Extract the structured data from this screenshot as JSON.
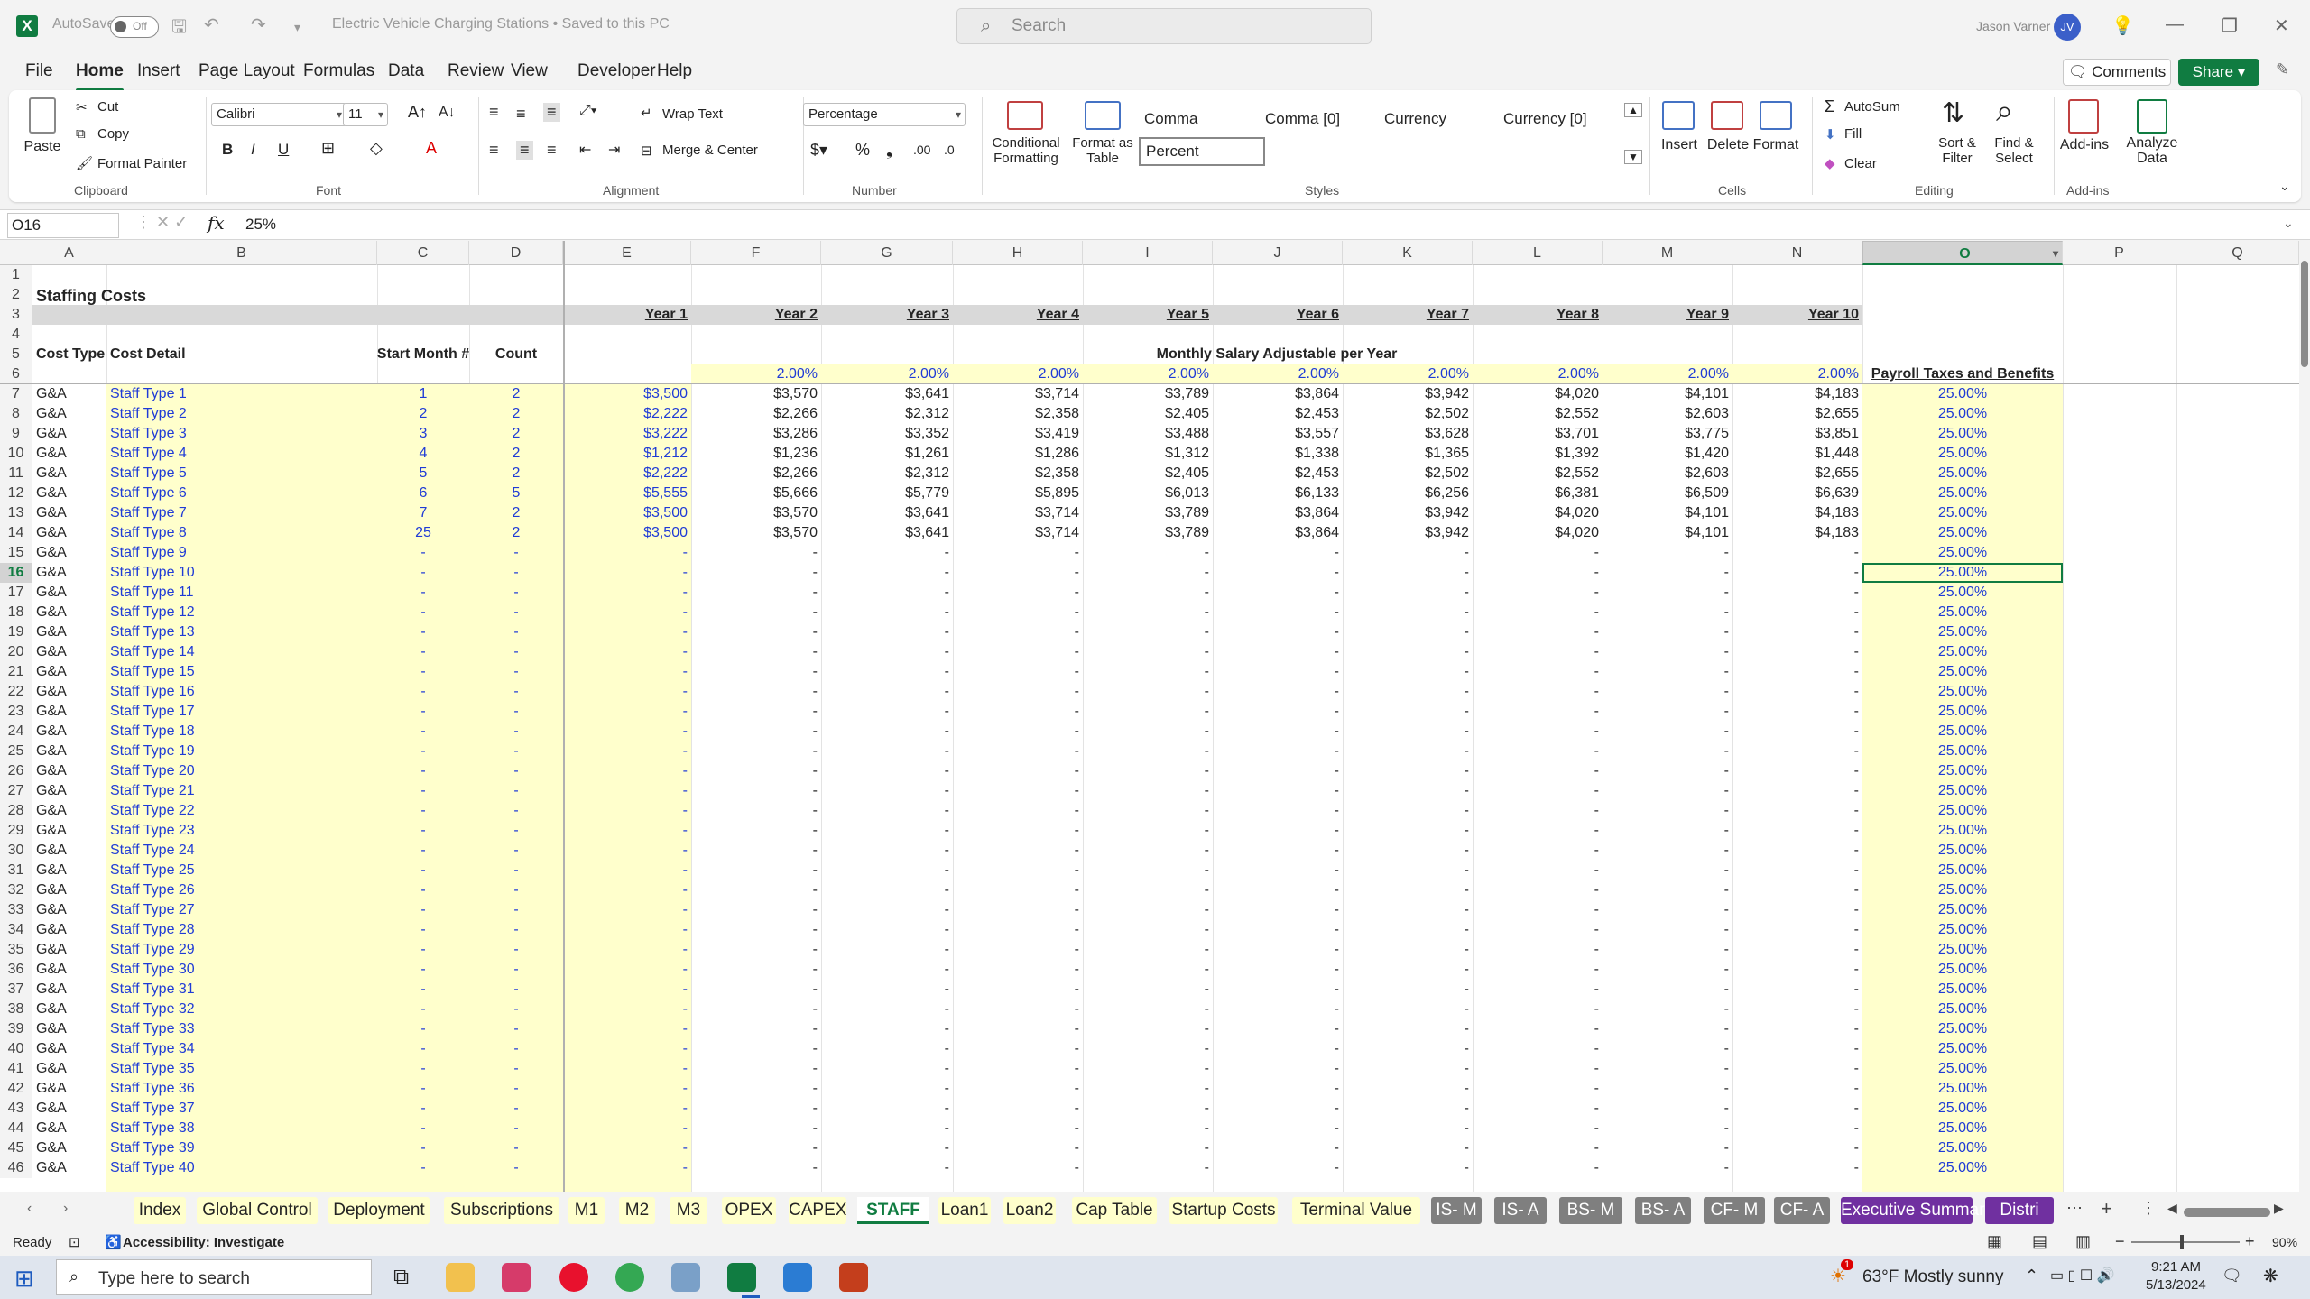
{
  "app": {
    "title": "Electric Vehicle Charging Stations  •  Saved to this PC",
    "autosave_label": "AutoSave",
    "autosave_state": "Off",
    "search_placeholder": "Search",
    "user_name": "Jason Varner",
    "user_initials": "JV"
  },
  "menu": [
    "File",
    "Home",
    "Insert",
    "Page Layout",
    "Formulas",
    "Data",
    "Review",
    "View",
    "Developer",
    "Help"
  ],
  "menu_active": "Home",
  "buttons": {
    "comments": "Comments",
    "share": "Share"
  },
  "ribbon": {
    "clipboard": {
      "paste": "Paste",
      "cut": "Cut",
      "copy": "Copy",
      "format_painter": "Format Painter",
      "group": "Clipboard"
    },
    "font": {
      "name": "Calibri",
      "size": "11",
      "group": "Font"
    },
    "alignment": {
      "wrap": "Wrap Text",
      "merge": "Merge & Center",
      "group": "Alignment"
    },
    "number": {
      "format": "Percentage",
      "group": "Number"
    },
    "styles": {
      "conditional": "Conditional Formatting",
      "format_table": "Format as Table",
      "cells": [
        "Comma",
        "Comma [0]",
        "Currency",
        "Currency [0]",
        "Percent"
      ],
      "group": "Styles"
    },
    "cells": {
      "insert": "Insert",
      "delete": "Delete",
      "format": "Format",
      "group": "Cells"
    },
    "editing": {
      "autosum": "AutoSum",
      "fill": "Fill",
      "clear": "Clear",
      "sort": "Sort & Filter",
      "find": "Find & Select",
      "group": "Editing"
    },
    "addins": {
      "addins": "Add-ins",
      "analyze": "Analyze Data",
      "group": "Add-ins"
    }
  },
  "formula_bar": {
    "cell": "O16",
    "value": "25%"
  },
  "columns": [
    "A",
    "B",
    "C",
    "D",
    "E",
    "F",
    "G",
    "H",
    "I",
    "J",
    "K",
    "L",
    "M",
    "N",
    "O",
    "P",
    "Q"
  ],
  "sheet": {
    "title": "Staffing Costs",
    "years": [
      "Year 1",
      "Year 2",
      "Year 3",
      "Year 4",
      "Year 5",
      "Year 6",
      "Year 7",
      "Year 8",
      "Year 9",
      "Year 10"
    ],
    "headers": {
      "cost_type": "Cost Type",
      "cost_detail": "Cost Detail",
      "start_month": "Start Month #",
      "count": "Count",
      "monthly": "Monthly Salary Adjustable per Year",
      "payroll": "Payroll Taxes and Benefits"
    },
    "growth": "2.00%",
    "payroll_rate": "25.00%",
    "dash": "-",
    "staff": [
      {
        "type": "G&A",
        "detail": "Staff Type 1",
        "start": "1",
        "count": "2",
        "salary": [
          "$3,500",
          "$3,570",
          "$3,641",
          "$3,714",
          "$3,789",
          "$3,864",
          "$3,942",
          "$4,020",
          "$4,101",
          "$4,183"
        ]
      },
      {
        "type": "G&A",
        "detail": "Staff Type 2",
        "start": "2",
        "count": "2",
        "salary": [
          "$2,222",
          "$2,266",
          "$2,312",
          "$2,358",
          "$2,405",
          "$2,453",
          "$2,502",
          "$2,552",
          "$2,603",
          "$2,655"
        ]
      },
      {
        "type": "G&A",
        "detail": "Staff Type 3",
        "start": "3",
        "count": "2",
        "salary": [
          "$3,222",
          "$3,286",
          "$3,352",
          "$3,419",
          "$3,488",
          "$3,557",
          "$3,628",
          "$3,701",
          "$3,775",
          "$3,851"
        ]
      },
      {
        "type": "G&A",
        "detail": "Staff Type 4",
        "start": "4",
        "count": "2",
        "salary": [
          "$1,212",
          "$1,236",
          "$1,261",
          "$1,286",
          "$1,312",
          "$1,338",
          "$1,365",
          "$1,392",
          "$1,420",
          "$1,448"
        ]
      },
      {
        "type": "G&A",
        "detail": "Staff Type 5",
        "start": "5",
        "count": "2",
        "salary": [
          "$2,222",
          "$2,266",
          "$2,312",
          "$2,358",
          "$2,405",
          "$2,453",
          "$2,502",
          "$2,552",
          "$2,603",
          "$2,655"
        ]
      },
      {
        "type": "G&A",
        "detail": "Staff Type 6",
        "start": "6",
        "count": "5",
        "salary": [
          "$5,555",
          "$5,666",
          "$5,779",
          "$5,895",
          "$6,013",
          "$6,133",
          "$6,256",
          "$6,381",
          "$6,509",
          "$6,639"
        ]
      },
      {
        "type": "G&A",
        "detail": "Staff Type 7",
        "start": "7",
        "count": "2",
        "salary": [
          "$3,500",
          "$3,570",
          "$3,641",
          "$3,714",
          "$3,789",
          "$3,864",
          "$3,942",
          "$4,020",
          "$4,101",
          "$4,183"
        ]
      },
      {
        "type": "G&A",
        "detail": "Staff Type 8",
        "start": "25",
        "count": "2",
        "salary": [
          "$3,500",
          "$3,570",
          "$3,641",
          "$3,714",
          "$3,789",
          "$3,864",
          "$3,942",
          "$4,020",
          "$4,101",
          "$4,183"
        ]
      }
    ],
    "empty_types": [
      "Staff Type 9",
      "Staff Type 10",
      "Staff Type 11",
      "Staff Type 12",
      "Staff Type 13",
      "Staff Type 14",
      "Staff Type 15",
      "Staff Type 16",
      "Staff Type 17",
      "Staff Type 18",
      "Staff Type 19",
      "Staff Type 20",
      "Staff Type 21",
      "Staff Type 22",
      "Staff Type 23",
      "Staff Type 24",
      "Staff Type 25",
      "Staff Type 26",
      "Staff Type 27",
      "Staff Type 28",
      "Staff Type 29",
      "Staff Type 30",
      "Staff Type 31",
      "Staff Type 32",
      "Staff Type 33",
      "Staff Type 34",
      "Staff Type 35",
      "Staff Type 36",
      "Staff Type 37",
      "Staff Type 38",
      "Staff Type 39",
      "Staff Type 40"
    ],
    "row_numbers": [
      "1",
      "2",
      "3",
      "4",
      "5",
      "6",
      "7",
      "8",
      "9",
      "10",
      "11",
      "12",
      "13",
      "14",
      "15",
      "16",
      "17",
      "18",
      "19",
      "20",
      "21",
      "22",
      "23",
      "24",
      "25",
      "26",
      "27",
      "28",
      "29",
      "30",
      "31",
      "32",
      "33",
      "34",
      "35",
      "36",
      "37",
      "38",
      "39",
      "40",
      "41",
      "42",
      "43",
      "44",
      "45",
      "46"
    ]
  },
  "tabs": [
    {
      "label": "Index",
      "style": "y"
    },
    {
      "label": "Global Control",
      "style": "y"
    },
    {
      "label": "Deployment",
      "style": "y"
    },
    {
      "label": "Subscriptions",
      "style": "y"
    },
    {
      "label": "M1",
      "style": "y"
    },
    {
      "label": "M2",
      "style": "y"
    },
    {
      "label": "M3",
      "style": "y"
    },
    {
      "label": "OPEX",
      "style": "y"
    },
    {
      "label": "CAPEX",
      "style": "y"
    },
    {
      "label": "STAFF",
      "style": "active"
    },
    {
      "label": "Loan1",
      "style": "y"
    },
    {
      "label": "Loan2",
      "style": "y"
    },
    {
      "label": "Cap Table",
      "style": "y"
    },
    {
      "label": "Startup Costs",
      "style": "y"
    },
    {
      "label": "Terminal Value",
      "style": "y"
    },
    {
      "label": "IS- M",
      "style": "g"
    },
    {
      "label": "IS- A",
      "style": "g"
    },
    {
      "label": "BS- M",
      "style": "g"
    },
    {
      "label": "BS- A",
      "style": "g"
    },
    {
      "label": "CF- M",
      "style": "g"
    },
    {
      "label": "CF- A",
      "style": "g"
    },
    {
      "label": "Executive Summary",
      "style": "p"
    },
    {
      "label": "Distri",
      "style": "p"
    }
  ],
  "status": {
    "ready": "Ready",
    "accessibility": "Accessibility: Investigate",
    "zoom": "90%"
  },
  "taskbar": {
    "search": "Type here to search",
    "weather": "63°F  Mostly sunny",
    "time": "9:21 AM",
    "date": "5/13/2024",
    "badge": "1"
  },
  "colors": {
    "excel_green": "#107c41",
    "input_yellow": "#ffffcc",
    "link_blue": "#1f3bd6",
    "tab_gray": "#7f7f7f",
    "tab_purple": "#7030a0"
  }
}
